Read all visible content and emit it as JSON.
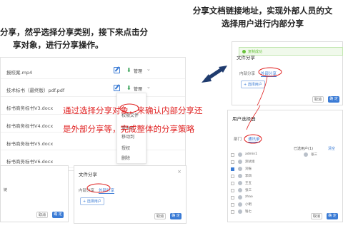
{
  "captions": {
    "left_line1": "分享，然乎选择分享类别，接下来点击分",
    "left_line2": "享对象，进行分享操作。",
    "right_line1": "分享文档链接地址，实现外部人员的文",
    "right_line2": "选择用户进行内部分享"
  },
  "files": [
    {
      "name": "报校案.mp4"
    },
    {
      "name": "技术标书（最终版）pdf.pdf"
    },
    {
      "name": "标书商务标书V3.docx"
    },
    {
      "name": "标书商务标书V4.docx"
    },
    {
      "name": "标书商务标书V5.docx"
    },
    {
      "name": "标书商务标书V6.docx"
    }
  ],
  "row_actions": {
    "manage_label": "管理",
    "chevron": "⌄",
    "download_glyph": "⬇"
  },
  "dropdown": {
    "items": [
      "权限文件",
      "重命名",
      "移动到",
      "授权",
      "删除"
    ]
  },
  "annotation": {
    "line1": "通过选择分享对象，来确认内部分享还",
    "line2": "是外部分享等，完成整体的分享策略"
  },
  "share_dialog": {
    "title": "文件分享",
    "tab_internal": "内部分享",
    "tab_external": "外部分享",
    "select_btn": "+ 选择用户",
    "cancel": "取消",
    "ok": "确 定"
  },
  "bl_panel": {
    "cancel": "取消",
    "ok": "确 定",
    "snippet": "链"
  },
  "tr_dialog": {
    "success": "复制成功",
    "title": "文件分享",
    "tab_internal": "内部分享",
    "tab_external": "外部分享",
    "select_btn": "+ 选择用户",
    "cancel": "取消",
    "ok": "确 定"
  },
  "user_dialog": {
    "title": "用户选择器",
    "col_dept": "部门",
    "col_user": "通讯录",
    "selected_label": "已选用户(1)",
    "clear": "清空",
    "users": [
      "admin1",
      "测试组",
      "刘振",
      "李四",
      "王五",
      "张三",
      "zhao",
      "小明",
      "钱七"
    ],
    "selected_users": [
      "张三"
    ],
    "cancel": "取消",
    "ok": "确 定"
  },
  "colors": {
    "accent": "#3a7bd5",
    "annotation": "#e02020",
    "success": "#67c23a",
    "arrow": "#1f3b6e"
  }
}
